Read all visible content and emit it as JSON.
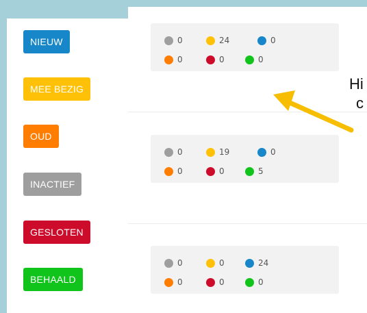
{
  "colors": {
    "nieuw": "#1787c9",
    "mee_bezig": "#ffc107",
    "oud": "#ff7d00",
    "inactief": "#9e9e9e",
    "gesloten": "#cd0b2b",
    "behaald": "#11c41b",
    "arrow": "#f7bd00"
  },
  "legend": [
    {
      "label": "NIEUW",
      "color": "#1787c9"
    },
    {
      "label": "MEE BEZIG",
      "color": "#ffc107"
    },
    {
      "label": "OUD",
      "color": "#ff7d00"
    },
    {
      "label": "INACTIEF",
      "color": "#9e9e9e"
    },
    {
      "label": "GESLOTEN",
      "color": "#cd0b2b"
    },
    {
      "label": "BEHAALD",
      "color": "#11c41b"
    }
  ],
  "cards": [
    {
      "inactief": "0",
      "mee_bezig": "24",
      "nieuw": "0",
      "oud": "0",
      "gesloten": "0",
      "behaald": "0"
    },
    {
      "inactief": "0",
      "mee_bezig": "19",
      "nieuw": "0",
      "oud": "0",
      "gesloten": "0",
      "behaald": "5"
    },
    {
      "inactief": "0",
      "mee_bezig": "0",
      "nieuw": "24",
      "oud": "0",
      "gesloten": "0",
      "behaald": "0"
    }
  ],
  "annotation": {
    "line1": "Hi",
    "line2": "c",
    "icon": "arrow-icon"
  }
}
